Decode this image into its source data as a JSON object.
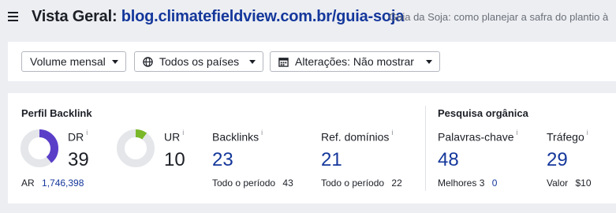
{
  "header": {
    "title_label": "Vista Geral:",
    "title_url": "blog.climatefieldview.com.br/guia-soja",
    "subtitle": "Guia da Soja: como planejar a safra do plantio à"
  },
  "filters": {
    "volume": "Volume mensal",
    "countries": "Todos os países",
    "changes": "Alterações: Não mostrar"
  },
  "backlink_profile": {
    "title": "Perfil Backlink",
    "dr": {
      "label": "DR",
      "info": "i",
      "value": "39",
      "fill": 0.39,
      "color": "#5b3ec8"
    },
    "ur": {
      "label": "UR",
      "info": "i",
      "value": "10",
      "fill": 0.1,
      "color": "#7ab829"
    },
    "ar": {
      "label": "AR",
      "value": "1,746,398"
    },
    "backlinks": {
      "label": "Backlinks",
      "info": "i",
      "value": "23",
      "sub_label": "Todo o período",
      "sub_value": "43"
    },
    "ref_domains": {
      "label": "Ref. domínios",
      "info": "i",
      "value": "21",
      "sub_label": "Todo o período",
      "sub_value": "22"
    }
  },
  "organic_search": {
    "title": "Pesquisa orgânica",
    "keywords": {
      "label": "Palavras-chave",
      "info": "i",
      "value": "48",
      "sub_label": "Melhores 3",
      "sub_value": "0"
    },
    "traffic": {
      "label": "Tráfego",
      "info": "i",
      "value": "29",
      "sub_label": "Valor",
      "sub_value": "$10"
    }
  },
  "colors": {
    "link_blue": "#14379b",
    "donut_track": "#e4e6ea",
    "background": "#eceef2"
  }
}
